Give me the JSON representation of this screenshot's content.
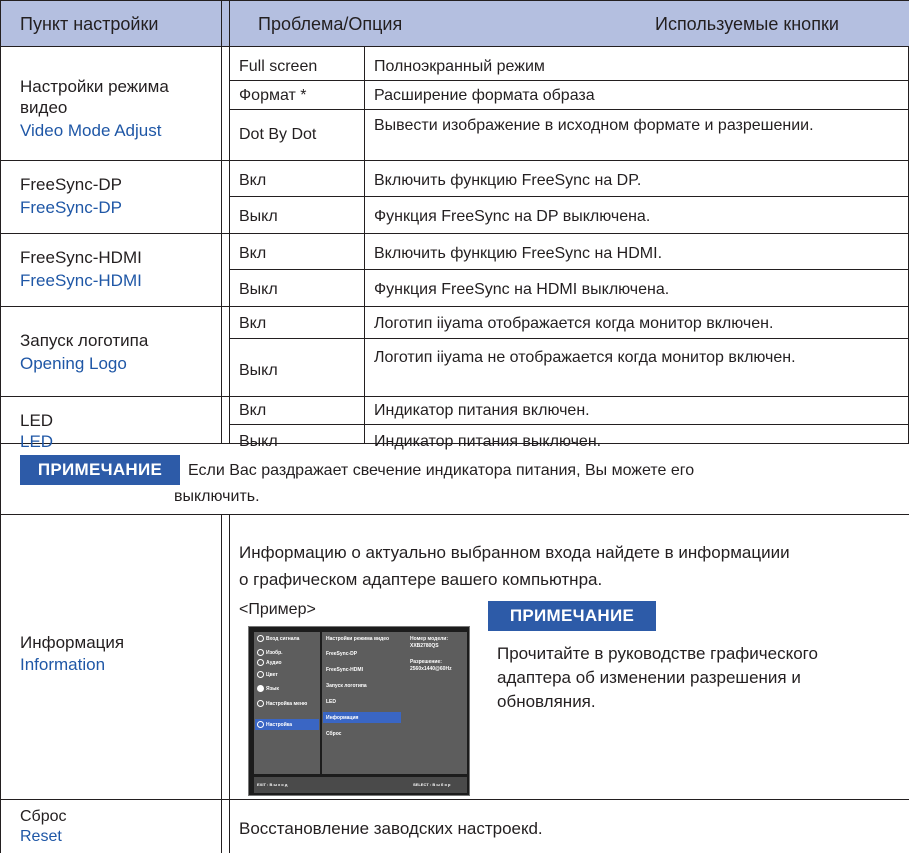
{
  "header": {
    "col1": "Пункт настройки",
    "col2": "Проблема/Опция",
    "col3": "Используемые кнопки"
  },
  "rows": {
    "video": {
      "title_ru": "Настройки режима видео",
      "title_en": "Video Mode Adjust",
      "options": [
        {
          "name": "Full screen",
          "desc": "Полноэкранный режим"
        },
        {
          "name": "Формат *",
          "desc": "Расширение формата образа"
        },
        {
          "name": "Dot By Dot",
          "desc": "Вывести изображение в исходном формате и разрешении."
        }
      ]
    },
    "freesync_dp": {
      "title_ru": "FreeSync-DP",
      "title_en": "FreeSync-DP",
      "options": [
        {
          "name": "Вкл",
          "desc": "Включить функцию FreeSync на DP."
        },
        {
          "name": "Выкл",
          "desc": "Функция FreeSync на DP выключена."
        }
      ]
    },
    "freesync_hdmi": {
      "title_ru": "FreeSync-HDMI",
      "title_en": "FreeSync-HDMI",
      "options": [
        {
          "name": "Вкл",
          "desc": "Включить функцию FreeSync на HDMI."
        },
        {
          "name": "Выкл",
          "desc": "Функция FreeSync на HDMI выключена."
        }
      ]
    },
    "logo": {
      "title_ru": "Запуск логотипа",
      "title_en": "Opening Logo",
      "options": [
        {
          "name": "Вкл",
          "desc": "Логотип iiyama отображается когда монитор включен."
        },
        {
          "name": "Выкл",
          "desc": "Логотип iiyama не отображается когда монитор включен."
        }
      ]
    },
    "led": {
      "title_ru": "LED",
      "title_en": "LED",
      "options": [
        {
          "name": "Вкл",
          "desc": "Индикатор питания включен."
        },
        {
          "name": "Выкл",
          "desc": "Индикатор питания выключен."
        }
      ]
    }
  },
  "note1": {
    "badge": "ПРИМЕЧАНИЕ",
    "line1": "Если Вас раздражает свечение индикатора питания, Вы можете его",
    "line2": "выключить."
  },
  "info": {
    "title_ru": "Информация",
    "title_en": "Information",
    "desc_line1": "Информацию о актуально выбранном входа найдете в информациии",
    "desc_line2": "о графическом адаптере вашего компьютнра.",
    "example_label": "<Пример>",
    "note_badge": "ПРИМЕЧАНИЕ",
    "note_line1": "Прочитайте в руководстве графического",
    "note_line2": "адаптера об изменении разрешения и",
    "note_line3": "обновляния."
  },
  "osd": {
    "menu": [
      "Вход сигнала",
      "Изобр.",
      "Аудио",
      "Цвет",
      "Язык",
      "Настройка меню",
      "Настройка"
    ],
    "submenu": [
      "Настройки режима видео",
      "FreeSync-DP",
      "FreeSync-HDMI",
      "Запуск логотипа",
      "LED",
      "Информация",
      "Сброс"
    ],
    "model_label": "Номер модели:",
    "model_value": "XXB2780QS",
    "res_label": "Разрешение:",
    "res_value": "2560x1440@60Hz",
    "exit": "EXIT : В ы х о д",
    "select": "SELECT : В ы б о р"
  },
  "reset": {
    "title_ru": "Сброс",
    "title_en": "Reset",
    "desc": "Восстановление заводских настроекd."
  }
}
